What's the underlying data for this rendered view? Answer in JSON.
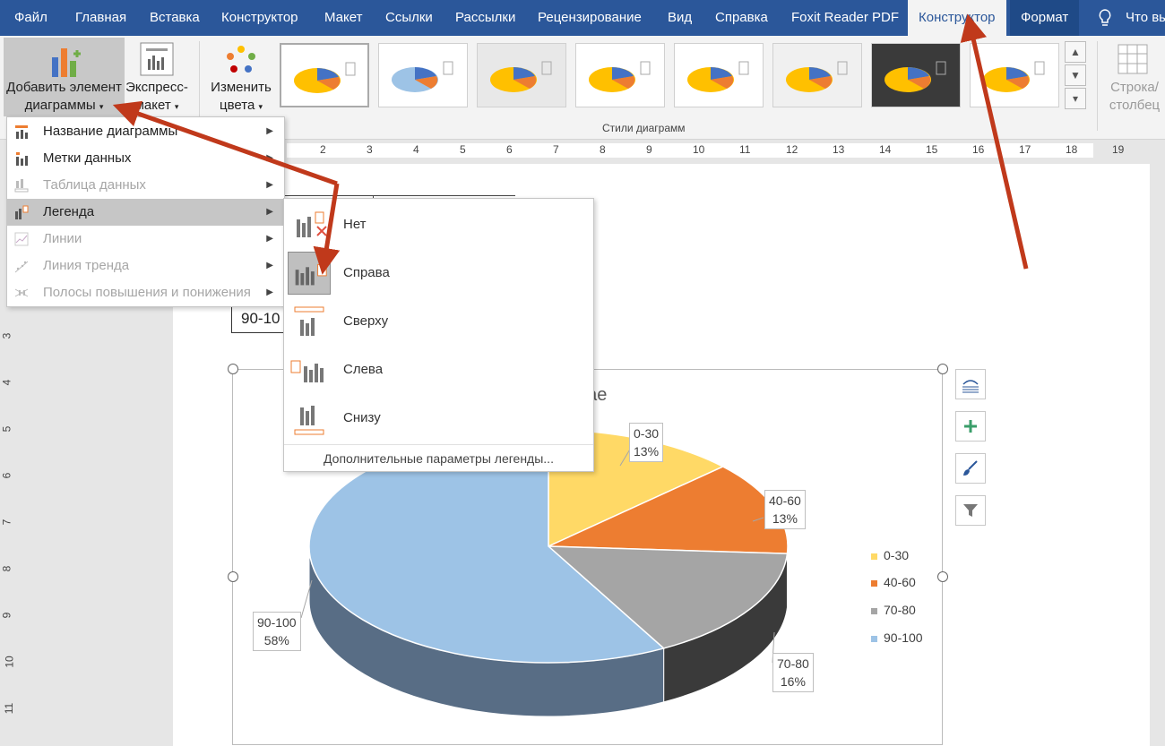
{
  "tabs": {
    "file": "Файл",
    "home": "Главная",
    "insert": "Вставка",
    "design": "Конструктор",
    "layout": "Макет",
    "references": "Ссылки",
    "mailings": "Рассылки",
    "review": "Рецензирование",
    "view": "Вид",
    "help": "Справка",
    "foxit": "Foxit Reader PDF",
    "chart_design": "Конструктор",
    "chart_format": "Формат",
    "tell_me": "Что вы"
  },
  "ribbon": {
    "add_element_line1": "Добавить элемент",
    "add_element_line2": "диаграммы",
    "quick_layout_line1": "Экспресс-",
    "quick_layout_line2": "макет",
    "change_colors_line1": "Изменить",
    "change_colors_line2": "цвета",
    "chart_styles_group": "Стили диаграмм",
    "switch_row_col_line1": "Строка/",
    "switch_row_col_line2": "столбец"
  },
  "ruler": {
    "h": [
      "2",
      "3",
      "4",
      "5",
      "6",
      "7",
      "8",
      "9",
      "10",
      "11",
      "12",
      "13",
      "14",
      "15",
      "16",
      "17",
      "18",
      "19"
    ],
    "v": [
      "3",
      "4",
      "5",
      "6",
      "7",
      "8",
      "9",
      "10",
      "11"
    ]
  },
  "menu": {
    "items": [
      {
        "label": "Название диаграммы",
        "icon": "chart-title-icon"
      },
      {
        "label": "Метки данных",
        "icon": "data-labels-icon"
      },
      {
        "label": "Таблица данных",
        "icon": "data-table-icon"
      },
      {
        "label": "Легенда",
        "icon": "legend-icon"
      },
      {
        "label": "Линии",
        "icon": "lines-icon"
      },
      {
        "label": "Линия тренда",
        "icon": "trendline-icon"
      },
      {
        "label": "Полосы повышения и понижения",
        "icon": "updown-bars-icon"
      }
    ]
  },
  "submenu": {
    "items": [
      {
        "label": "Нет",
        "icon": "legend-none-icon"
      },
      {
        "label": "Справа",
        "icon": "legend-right-icon"
      },
      {
        "label": "Сверху",
        "icon": "legend-top-icon"
      },
      {
        "label": "Слева",
        "icon": "legend-left-icon"
      },
      {
        "label": "Снизу",
        "icon": "legend-bottom-icon"
      }
    ],
    "more": "Дополнительные параметры легенды..."
  },
  "document": {
    "table_cell": "90-10"
  },
  "colors": {
    "accent": "#2b579a",
    "slice1": "#ffd966",
    "slice2": "#ed7d31",
    "slice3": "#a5a5a5",
    "slice4": "#9dc3e6",
    "arrow": "#c0391b"
  },
  "chart_data": {
    "type": "pie",
    "title": "ть в мае",
    "categories": [
      "0-30",
      "40-60",
      "70-80",
      "90-100"
    ],
    "values": [
      13,
      13,
      16,
      58
    ],
    "labels": [
      "13%",
      "13%",
      "16%",
      "58%"
    ],
    "legend_position": "right"
  }
}
